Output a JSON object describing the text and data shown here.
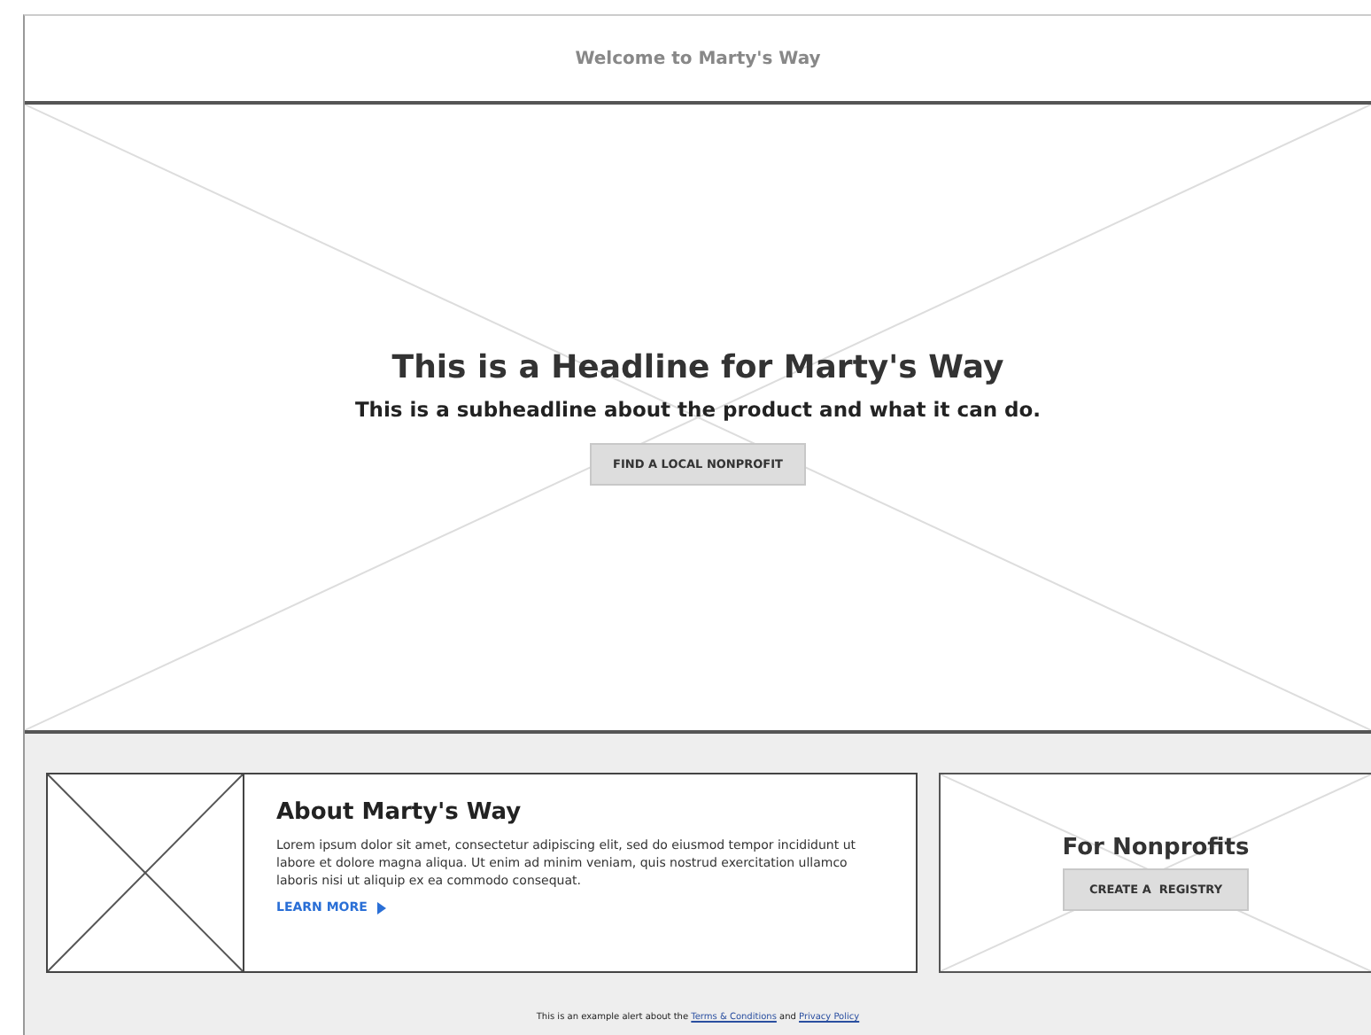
{
  "header": {
    "title": "Welcome to Marty's Way"
  },
  "hero": {
    "headline": "This is a Headline for Marty's Way",
    "subheadline": "This is a subheadline about the product and what it can do.",
    "button": "FIND A LOCAL NONPROFIT"
  },
  "about": {
    "title": "About Marty's Way",
    "body": "Lorem ipsum dolor sit amet, consectetur adipiscing elit, sed do eiusmod tempor incididunt ut labore et dolore magna aliqua. Ut enim ad minim veniam, quis nostrud exercitation ullamco laboris nisi ut aliquip ex ea commodo consequat.",
    "link": "LEARN MORE"
  },
  "nonprofits": {
    "title": "For Nonprofits",
    "button": "CREATE A  REGISTRY"
  },
  "footer": {
    "parts": [
      {
        "kind": "text",
        "text": "This is an example alert about the "
      },
      {
        "kind": "link",
        "text": "Terms & Conditions"
      },
      {
        "kind": "text",
        "text": " and "
      },
      {
        "kind": "link",
        "text": "Privacy Policy"
      }
    ]
  }
}
